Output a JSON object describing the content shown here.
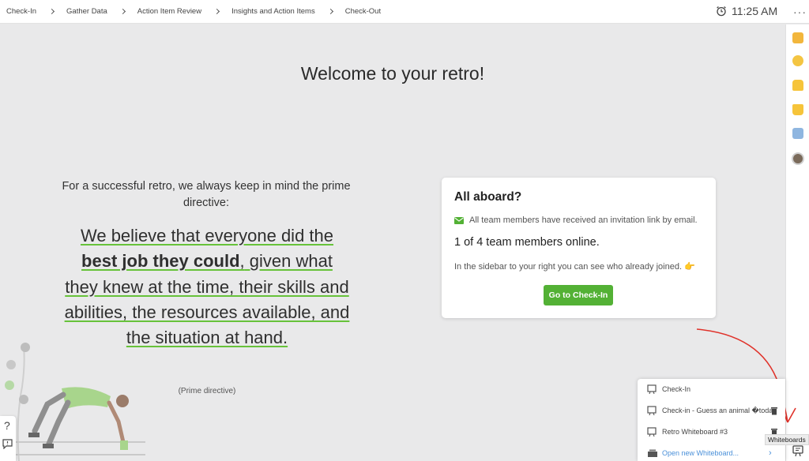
{
  "breadcrumbs": [
    "Check-In",
    "Gather Data",
    "Action Item Review",
    "Insights and Action Items",
    "Check-Out"
  ],
  "clock": {
    "time": "11:25 AM",
    "icon": "alarm-clock-icon"
  },
  "menu": {
    "more_label": "···"
  },
  "main": {
    "title": "Welcome to your retro!",
    "intro": "For a successful retro, we always keep in mind the prime directive:",
    "directive": {
      "p1": "We believe that everyone did the",
      "bold": "best job they could",
      "p2": ",",
      "p3": " given what they knew at the time, their skills and abilities, the resources available, and the situation at hand."
    },
    "directive_label": "(Prime directive)"
  },
  "card": {
    "title": "All aboard?",
    "invite_text": "All team members have received an invitation link by email.",
    "online_text": "1 of 4 team members online.",
    "hint": "In the sidebar to your right you can see who already joined. 👉",
    "button": "Go to Check-In"
  },
  "whiteboards": {
    "items": [
      {
        "label": "Check-In",
        "deletable": false
      },
      {
        "label": "Check-in - Guess an animal �today",
        "deletable": true
      },
      {
        "label": "Retro Whiteboard #3",
        "deletable": true
      }
    ],
    "new_label": "Open new Whiteboard...",
    "tooltip": "Whiteboards"
  },
  "help": {
    "question": "?"
  },
  "colors": {
    "accent": "#53b135",
    "underline": "#67c23a",
    "annotation": "#e0322a",
    "link": "#4a90d9"
  }
}
